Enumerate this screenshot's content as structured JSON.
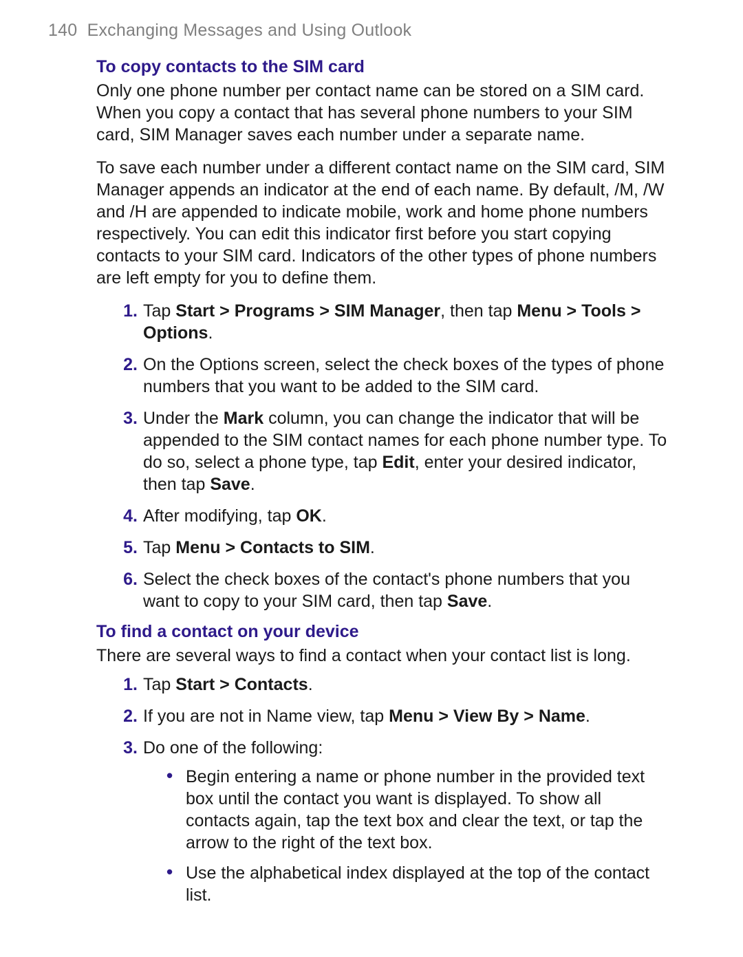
{
  "header": {
    "page_number": "140",
    "chapter": "Exchanging Messages and Using Outlook"
  },
  "sections": [
    {
      "title": "To copy contacts to the SIM card",
      "paragraphs": [
        "Only one phone number per contact name can be stored on a SIM card. When you copy a contact that has several phone numbers to your SIM card, SIM Manager saves each number under a separate name.",
        "To save each number under a different contact name on the SIM card, SIM Manager appends an indicator at the end of each name. By default, /M, /W and /H are appended to indicate mobile, work and home phone numbers respectively. You can edit this indicator first before you start copying contacts to your SIM card. Indicators of the other types of phone numbers are left empty for you to define them."
      ],
      "steps": [
        {
          "fragments": [
            {
              "t": "Tap "
            },
            {
              "t": "Start > Programs > SIM Manager",
              "b": true
            },
            {
              "t": ", then tap "
            },
            {
              "t": "Menu > Tools > Options",
              "b": true
            },
            {
              "t": "."
            }
          ]
        },
        {
          "fragments": [
            {
              "t": "On the Options screen, select the check boxes of the types of phone numbers that you want to be added to the SIM card."
            }
          ]
        },
        {
          "fragments": [
            {
              "t": "Under the "
            },
            {
              "t": "Mark",
              "b": true
            },
            {
              "t": " column, you can change the indicator that will be appended to the SIM contact names for each phone number type. To do so, select a phone type, tap "
            },
            {
              "t": "Edit",
              "b": true
            },
            {
              "t": ", enter your desired indicator, then tap "
            },
            {
              "t": "Save",
              "b": true
            },
            {
              "t": "."
            }
          ]
        },
        {
          "fragments": [
            {
              "t": "After modifying, tap "
            },
            {
              "t": "OK",
              "b": true
            },
            {
              "t": "."
            }
          ]
        },
        {
          "fragments": [
            {
              "t": "Tap "
            },
            {
              "t": "Menu > Contacts to SIM",
              "b": true
            },
            {
              "t": "."
            }
          ]
        },
        {
          "fragments": [
            {
              "t": "Select the check boxes of the contact's phone numbers that you want to copy to your SIM card, then tap "
            },
            {
              "t": "Save",
              "b": true
            },
            {
              "t": "."
            }
          ]
        }
      ]
    },
    {
      "title": "To find a contact on your device",
      "paragraphs": [
        "There are several ways to find a contact when your contact list is long."
      ],
      "steps": [
        {
          "fragments": [
            {
              "t": "Tap "
            },
            {
              "t": "Start > Contacts",
              "b": true
            },
            {
              "t": "."
            }
          ]
        },
        {
          "fragments": [
            {
              "t": "If you are not in Name view, tap "
            },
            {
              "t": "Menu > View By > Name",
              "b": true
            },
            {
              "t": "."
            }
          ]
        },
        {
          "fragments": [
            {
              "t": "Do one of the following:"
            }
          ],
          "bullets": [
            "Begin entering a name or phone number in the provided text box until the contact you want is displayed. To show all contacts again, tap the text box and clear the text, or tap the arrow to the right of the text box.",
            "Use the alphabetical index displayed at the top of the contact list."
          ]
        }
      ]
    }
  ]
}
